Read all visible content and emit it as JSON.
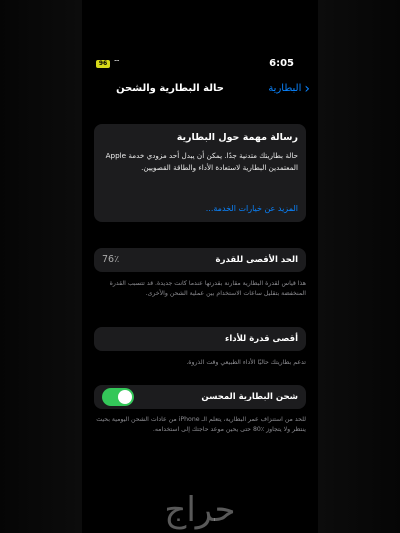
{
  "status": {
    "time": "6:05",
    "battery": "96"
  },
  "nav": {
    "back_label": "البطارية",
    "title": "حالة البطارية والشحن"
  },
  "message": {
    "title": "رسالة مهمة حول البطارية",
    "body": "حالة بطاريتك متدنية جدًا. يمكن أن يبدل أحد مزودي خدمة Apple المعتمدين البطارية لاستعادة الأداء والطاقة القصويين.",
    "link": "المزيد عن خيارات الخدمة..."
  },
  "capacity": {
    "label": "الحد الأقصى للقدرة",
    "value": "76٪",
    "note": "هذا قياس لقدرة البطارية مقارنة بقدرتها عندما كانت جديدة. قد تتسبب القدرة المنخفضة بتقليل ساعات الاستخدام بين عملية الشحن والأخرى."
  },
  "performance": {
    "label": "أقصى قدرة للأداء",
    "note": "تدعم بطاريتك حاليًا الأداء الطبيعي وقت الذروة."
  },
  "optimized_charging": {
    "label": "شحن البطارية المحسن",
    "enabled": true,
    "note": "للحد من استنزاف عمر البطارية، يتعلم الـ iPhone من عادات الشحن اليومية بحيث ينتظر ولا يتجاوز ‎80٪ حتى يحين موعد حاجتك إلى استخدامه."
  },
  "watermark": "حراج",
  "colors": {
    "accent": "#0a84ff",
    "toggle_on": "#34c759",
    "card": "#1c1c1e",
    "battery": "#d7d91a"
  }
}
